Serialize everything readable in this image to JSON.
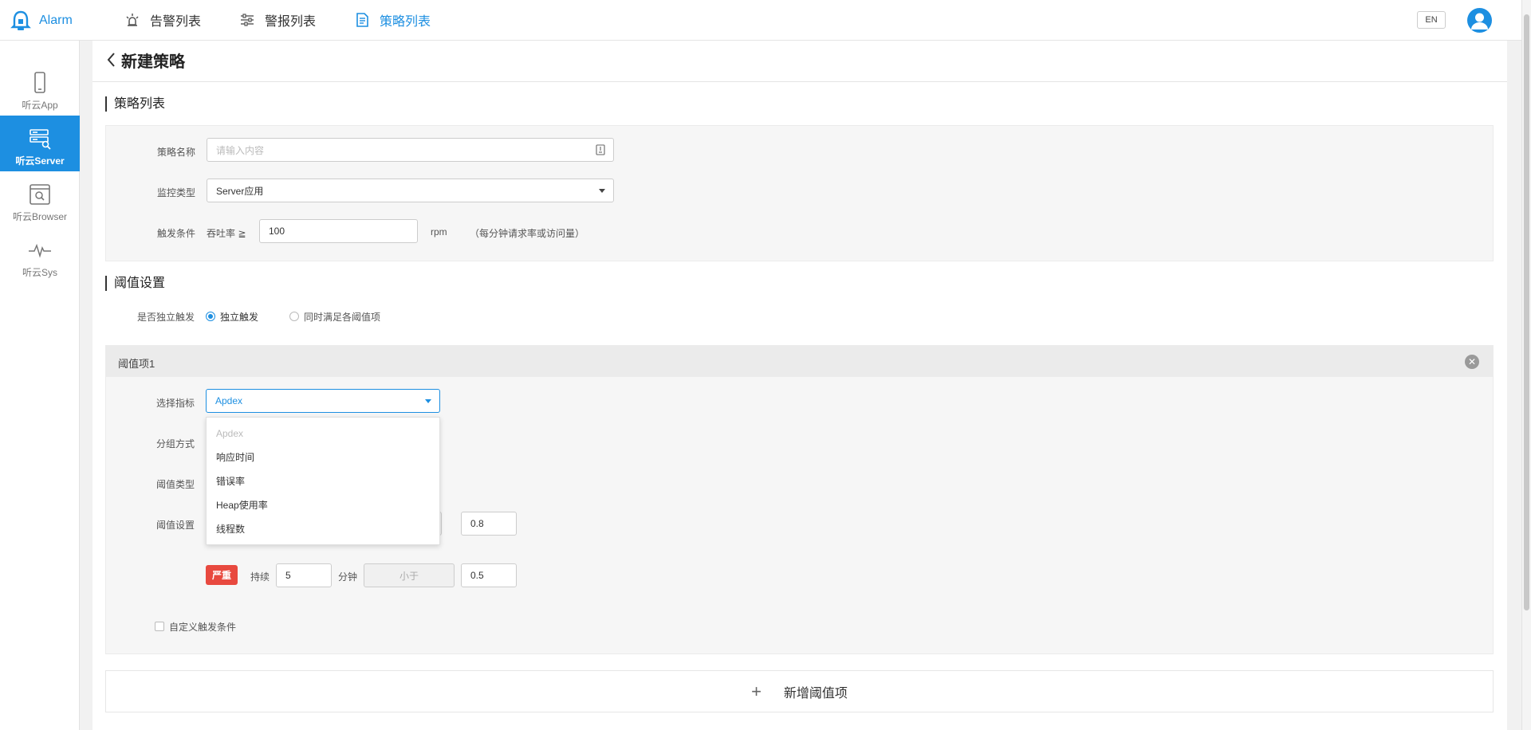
{
  "app": {
    "name": "Alarm"
  },
  "topnav": {
    "items": [
      {
        "label": "告警列表",
        "icon": "alarm-light-icon"
      },
      {
        "label": "警报列表",
        "icon": "sliders-icon"
      },
      {
        "label": "策略列表",
        "icon": "document-icon"
      }
    ],
    "active": 2,
    "lang_label": "EN"
  },
  "sidebar": {
    "items": [
      {
        "label": "听云App",
        "icon": "phone-icon"
      },
      {
        "label": "听云Server",
        "icon": "server-icon"
      },
      {
        "label": "听云Browser",
        "icon": "browser-icon"
      },
      {
        "label": "听云Sys",
        "icon": "pulse-icon"
      }
    ],
    "active": 1
  },
  "page": {
    "title": "新建策略"
  },
  "policy_section": {
    "title": "策略列表",
    "name_label": "策略名称",
    "name_placeholder": "请输入内容",
    "monitor_label": "监控类型",
    "monitor_value": "Server应用",
    "trigger_label": "触发条件",
    "trigger_prefix": "吞吐率 ≧",
    "trigger_value": "100",
    "trigger_unit": "rpm",
    "trigger_note": "（每分钟请求率或访问量）"
  },
  "threshold_section": {
    "title": "阈值设置",
    "independent_label": "是否独立触发",
    "option_independent": "独立触发",
    "option_all": "同时满足各阈值项",
    "selected": "independent"
  },
  "threshold_item": {
    "title": "阈值项1",
    "metric_label": "选择指标",
    "metric_value": "Apdex",
    "group_label": "分组方式",
    "type_label": "阈值类型",
    "setting_label": "阈值设置",
    "warning_value": "0.8",
    "severity_badge": "严重",
    "duration_label": "持续",
    "duration_value": "5",
    "minutes_label": "分钟",
    "operator_value": "小于",
    "critical_value": "0.5",
    "custom_label": "自定义触发条件",
    "custom_checked": false
  },
  "metric_dropdown": {
    "options": [
      "Apdex",
      "响应时间",
      "错误率",
      "Heap使用率",
      "线程数"
    ],
    "disabled_index": 0
  },
  "add_button": {
    "label": "新增阈值项"
  },
  "colors": {
    "accent": "#1d8fe1",
    "danger": "#e8493f"
  }
}
